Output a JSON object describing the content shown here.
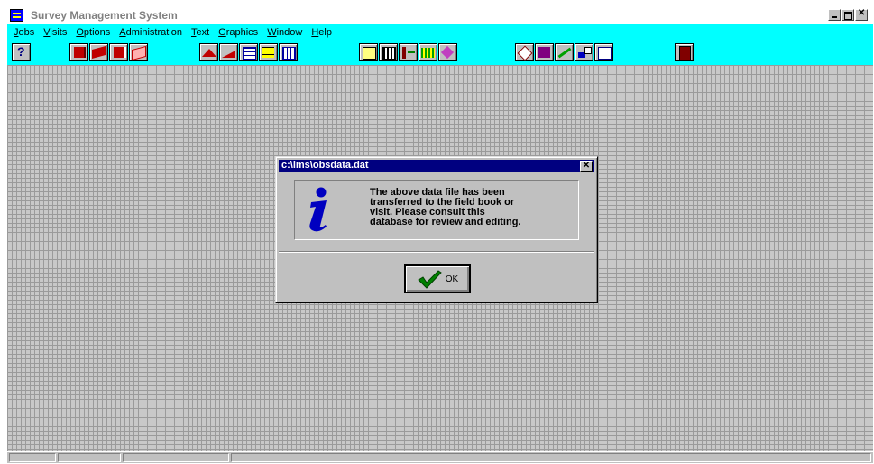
{
  "app": {
    "title": "Survey Management System",
    "title_color": "#808080",
    "menubar_color": "#00ffff"
  },
  "menu": {
    "items": [
      "Jobs",
      "Visits",
      "Options",
      "Administration",
      "Text",
      "Graphics",
      "Window",
      "Help"
    ]
  },
  "toolbar": {
    "help_label": "?",
    "icons": [
      "help-icon",
      "red-book-icon",
      "red-books-icon",
      "red-page-icon",
      "pink-pages-icon",
      "red-triangle-icon",
      "red-wedge-icon",
      "table-grid-icon",
      "yellow-table-icon",
      "data-grid-icon",
      "copy-table-icon",
      "calculator-icon",
      "chart-bars-icon",
      "green-chart-icon",
      "purple-shape-icon",
      "diamond-icon",
      "purple-square-icon",
      "green-pencil-icon",
      "drag-icon",
      "blank-window-icon",
      "exit-door-icon"
    ]
  },
  "dialog": {
    "title": "c:\\lms\\obsdata.dat",
    "close_label": "✕",
    "message": "The above data file has been\ntransferred to the field book or\nvisit. Please consult this\ndatabase for review and editing.",
    "icon": "info-icon",
    "ok_label": "OK",
    "title_color": "#000080"
  }
}
